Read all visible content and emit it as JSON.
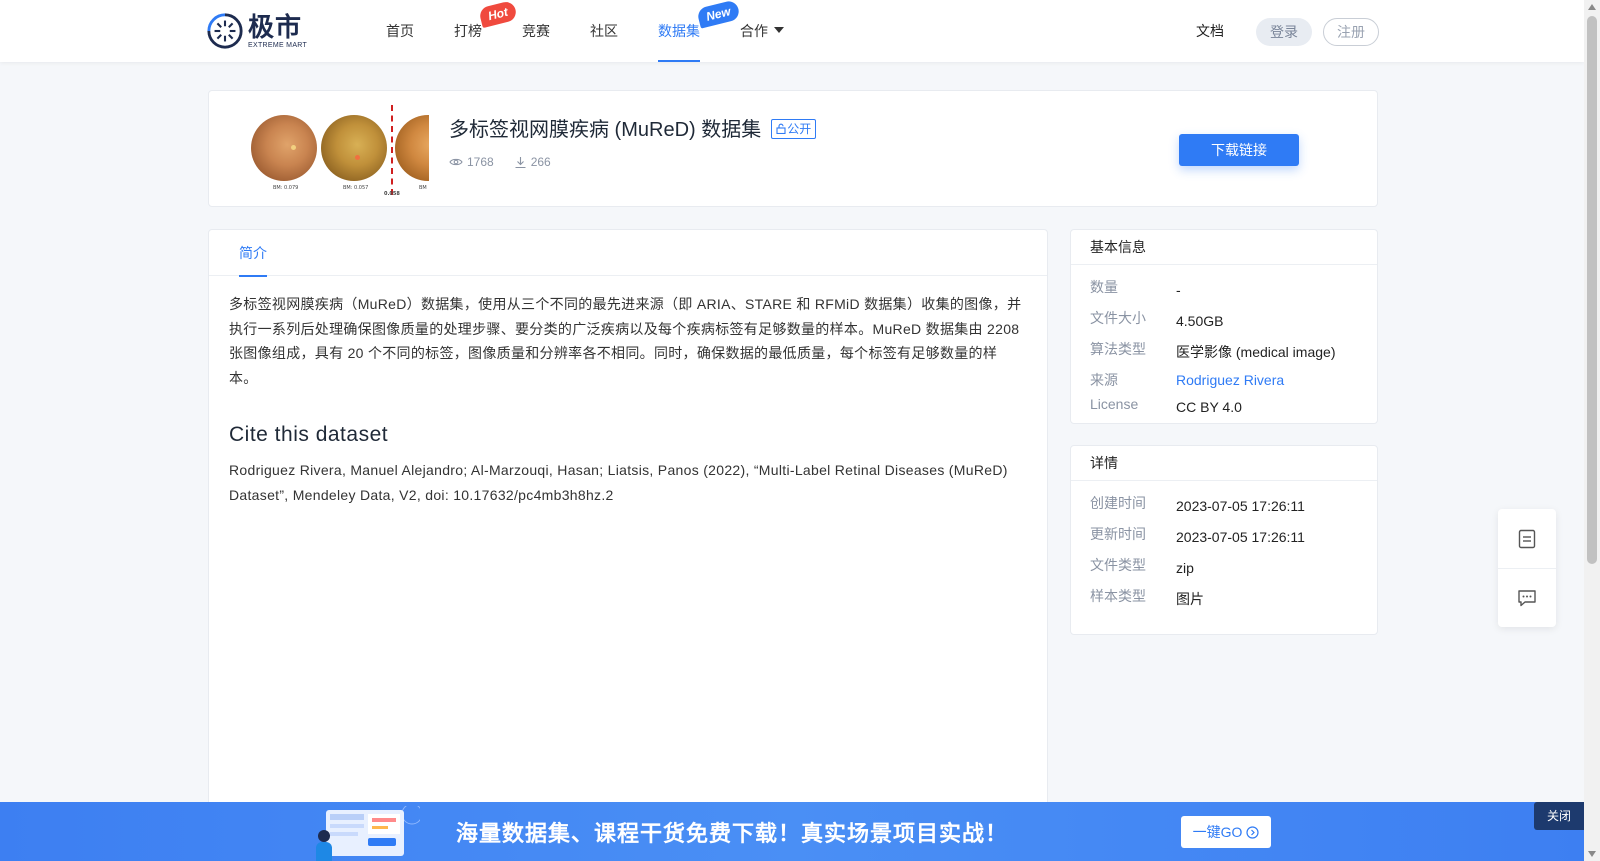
{
  "header": {
    "logo_cn": "极市",
    "logo_en": "EXTREME MART",
    "nav": [
      {
        "label": "首页"
      },
      {
        "label": "打榜",
        "badge": "Hot"
      },
      {
        "label": "竞赛"
      },
      {
        "label": "社区"
      },
      {
        "label": "数据集",
        "badge": "New"
      },
      {
        "label": "合作"
      }
    ],
    "docs": "文档",
    "login": "登录",
    "register": "注册"
  },
  "dataset": {
    "title": "多标签视网膜疾病 (MuReD) 数据集",
    "visibility": "公开",
    "views": "1768",
    "downloads": "266",
    "download_button": "下载链接",
    "thumb_labels": [
      "BM: 0.079",
      "BM: 0.057",
      "0.058",
      "BM"
    ]
  },
  "tabs": {
    "intro": "简介"
  },
  "content": {
    "intro": "多标签视网膜疾病（MuReD）数据集，使用从三个不同的最先进来源（即 ARIA、STARE 和 RFMiD 数据集）收集的图像，并执行一系列后处理确保图像质量的处理步骤、要分类的广泛疾病以及每个疾病标签有足够数量的样本。MuReD 数据集由 2208 张图像组成，具有 20 个不同的标签，图像质量和分辨率各不相同。同时，确保数据的最低质量，每个标签有足够数量的样本。",
    "cite_heading": "Cite this dataset",
    "cite_text": "Rodriguez Rivera, Manuel Alejandro; Al-Marzouqi, Hasan; Liatsis, Panos (2022), “Multi-Label Retinal Diseases (MuReD) Dataset”, Mendeley Data, V2, doi: 10.17632/pc4mb3h8hz.2"
  },
  "basic_info": {
    "heading": "基本信息",
    "rows": [
      {
        "key": "数量",
        "value": "-"
      },
      {
        "key": "文件大小",
        "value": "4.50GB"
      },
      {
        "key": "算法类型",
        "value": "医学影像 (medical image)"
      },
      {
        "key": "来源",
        "value": "Rodriguez Rivera"
      },
      {
        "key": "License",
        "value": "CC BY 4.0"
      }
    ]
  },
  "details": {
    "heading": "详情",
    "rows": [
      {
        "key": "创建时间",
        "value": "2023-07-05 17:26:11"
      },
      {
        "key": "更新时间",
        "value": "2023-07-05 17:26:11"
      },
      {
        "key": "文件类型",
        "value": "zip"
      },
      {
        "key": "样本类型",
        "value": "图片"
      }
    ]
  },
  "banner": {
    "text": "海量数据集、课程干货免费下载！真实场景项目实战！",
    "go_button": "一键GO",
    "close": "关闭"
  },
  "icons": {
    "views": "eye-icon",
    "downloads": "download-icon",
    "public": "lock-icon",
    "doc_tool": "document-icon",
    "feedback_tool": "message-icon"
  },
  "colors": {
    "accent": "#2f7bf5",
    "hot": "#f04a3e",
    "banner": "#4a8ff5"
  }
}
